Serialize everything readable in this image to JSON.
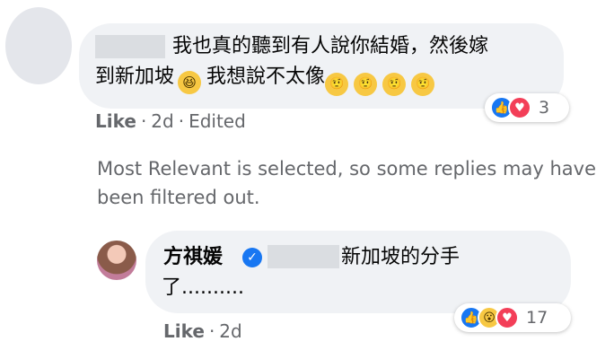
{
  "comment1": {
    "line1": "我也真的聽到有人說你結婚，然後嫁",
    "line2": "到新加坡",
    "line2b": "我想說不太像",
    "reactions_count": "3",
    "actions": {
      "like": "Like",
      "time": "2d",
      "edited": "Edited"
    }
  },
  "notice": "Most Relevant is selected, so some replies may have been filtered out.",
  "reply": {
    "name": "方祺媛",
    "text_line1": "新加坡的分手",
    "text_line2": "了..........",
    "reactions_count": "17",
    "actions": {
      "like": "Like",
      "time": "2d"
    }
  },
  "icons": {
    "like": "thumbs-up-icon",
    "love": "heart-icon",
    "wow": "wow-face-icon",
    "laugh": "laughing-emoji-icon",
    "thinking": "thinking-emoji-icon",
    "verified": "verified-badge-icon"
  },
  "colors": {
    "bubble": "#f0f2f5",
    "like_blue": "#1877f2",
    "love_red": "#f33e58",
    "meta_gray": "#65676b"
  }
}
